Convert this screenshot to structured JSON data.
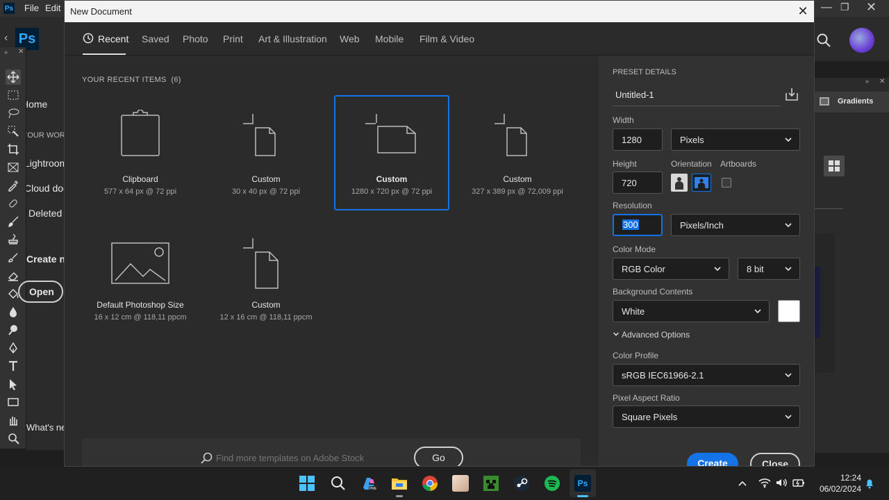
{
  "ps": {
    "logo": "Ps",
    "menu_file": "File",
    "menu_edit": "Edit"
  },
  "home": {
    "items": [
      "Home",
      "YOUR WORK",
      "Lightroom",
      "Cloud docs",
      "Deleted"
    ],
    "create_new": "Create new",
    "open": "Open",
    "whats_new": "What's new"
  },
  "right_panel": {
    "gradients": "Gradients"
  },
  "dialog": {
    "title": "New Document",
    "tabs": [
      "Recent",
      "Saved",
      "Photo",
      "Print",
      "Art & Illustration",
      "Web",
      "Mobile",
      "Film & Video"
    ],
    "recent_heading": "YOUR RECENT ITEMS",
    "recent_count": "(6)",
    "items": [
      {
        "name": "Clipboard",
        "detail": "577 x 64 px @ 72 ppi",
        "icon": "clipboard-icon"
      },
      {
        "name": "Custom",
        "detail": "30 x 40 px @ 72 ppi",
        "icon": "document-portrait-icon"
      },
      {
        "name": "Custom",
        "detail": "1280 x 720 px @ 72 ppi",
        "icon": "document-landscape-icon"
      },
      {
        "name": "Custom",
        "detail": "327 x 389 px @ 72,009 ppi",
        "icon": "document-portrait-icon"
      },
      {
        "name": "Default Photoshop Size",
        "detail": "16 x 12 cm @ 118,11 ppcm",
        "icon": "image-icon"
      },
      {
        "name": "Custom",
        "detail": "12 x 16 cm @ 118,11 ppcm",
        "icon": "document-portrait-icon"
      }
    ],
    "stock_placeholder": "Find more templates on Adobe Stock",
    "go": "Go"
  },
  "preset": {
    "heading": "PRESET DETAILS",
    "name": "Untitled-1",
    "width_label": "Width",
    "width": "1280",
    "width_unit": "Pixels",
    "height_label": "Height",
    "height": "720",
    "orientation_label": "Orientation",
    "artboards_label": "Artboards",
    "resolution_label": "Resolution",
    "resolution": "300",
    "resolution_unit": "Pixels/Inch",
    "color_mode_label": "Color Mode",
    "color_mode": "RGB Color",
    "bit_depth": "8 bit",
    "bg_label": "Background Contents",
    "bg": "White",
    "advanced": "Advanced Options",
    "profile_label": "Color Profile",
    "profile": "sRGB IEC61966-2.1",
    "aspect_label": "Pixel Aspect Ratio",
    "aspect": "Square Pixels",
    "create": "Create",
    "close": "Close"
  },
  "taskbar": {
    "time": "12:24",
    "date": "06/02/2024"
  },
  "colors": {
    "accent": "#1473e6",
    "dialog_bg": "#2b2b2b",
    "panel_bg": "#323232"
  }
}
